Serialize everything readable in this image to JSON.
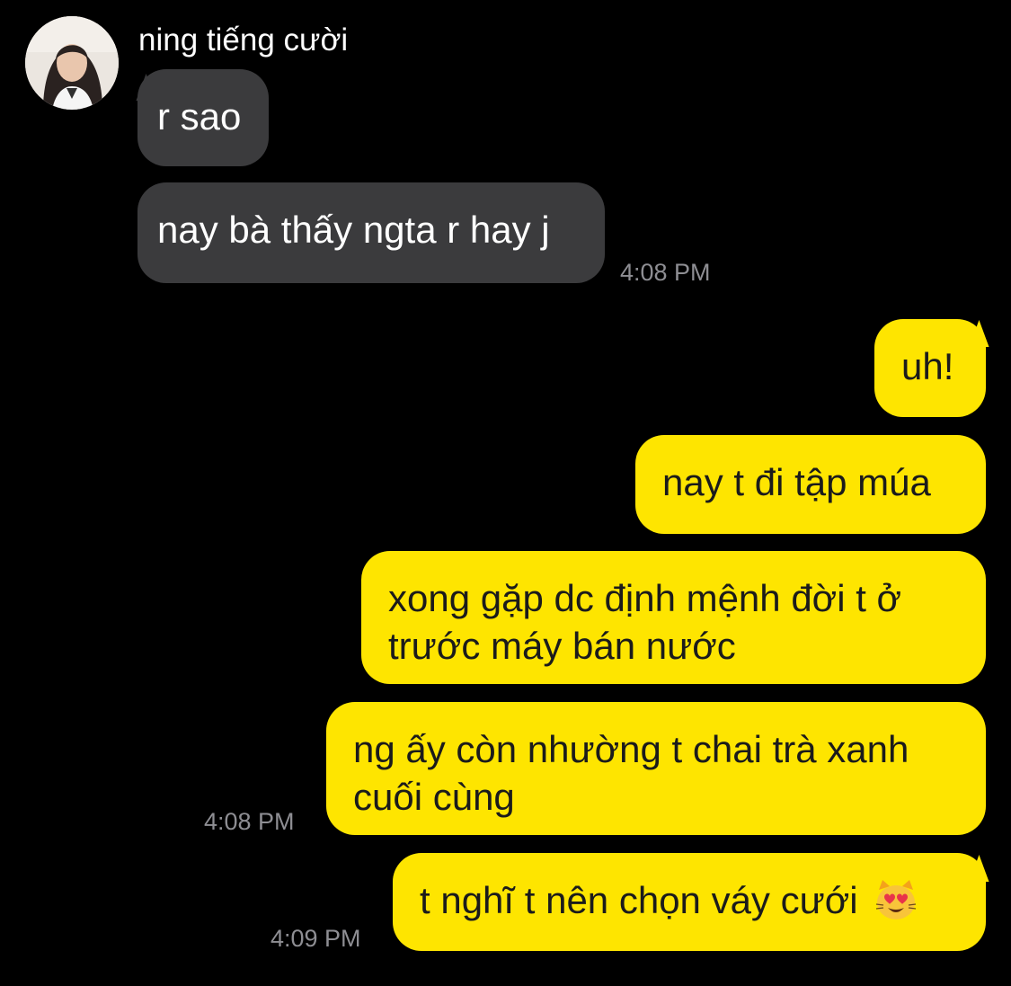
{
  "chat": {
    "sender_name": "ning tiếng cười",
    "messages_in": [
      {
        "text": "r sao"
      },
      {
        "text": "nay bà thấy ngta r hay j"
      }
    ],
    "time_in": "4:08 PM",
    "messages_out": [
      {
        "text": "uh!"
      },
      {
        "text": "nay t đi tập múa"
      },
      {
        "line1": "xong gặp dc định mệnh đời t ở",
        "line2": "trước máy bán nước"
      },
      {
        "line1": "ng ấy còn nhường t chai trà xanh",
        "line2": "cuối cùng"
      },
      {
        "text": "t nghĩ t nên chọn váy cưới",
        "emoji": "heart-eyes-cat-emoji"
      }
    ],
    "time_out_1": "4:08 PM",
    "time_out_2": "4:09 PM"
  },
  "colors": {
    "background": "#000000",
    "incoming_bubble": "#3b3b3d",
    "outgoing_bubble": "#fee500",
    "timestamp": "#8e8e93"
  }
}
